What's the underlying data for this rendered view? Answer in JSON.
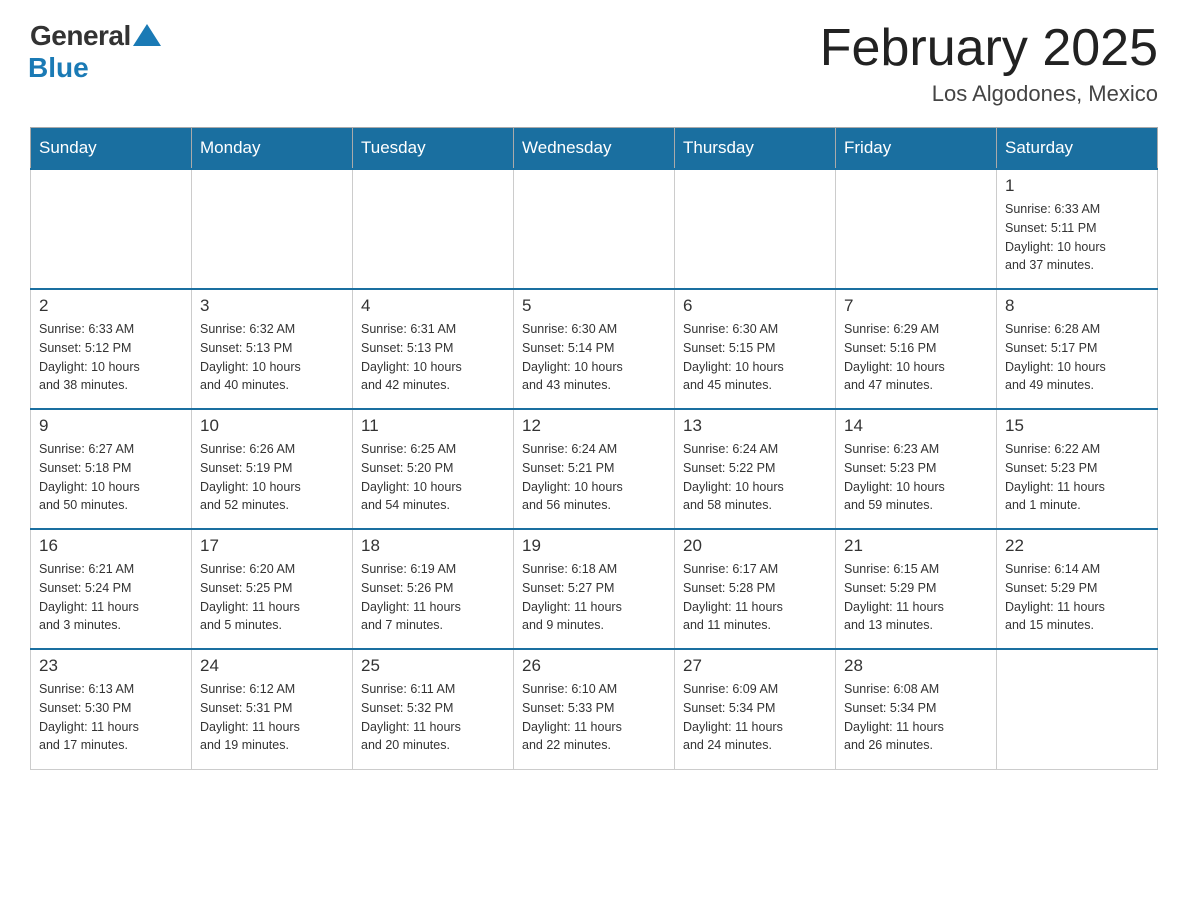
{
  "header": {
    "logo_general": "General",
    "logo_blue": "Blue",
    "month_title": "February 2025",
    "location": "Los Algodones, Mexico"
  },
  "weekdays": [
    "Sunday",
    "Monday",
    "Tuesday",
    "Wednesday",
    "Thursday",
    "Friday",
    "Saturday"
  ],
  "weeks": [
    [
      {
        "day": "",
        "info": ""
      },
      {
        "day": "",
        "info": ""
      },
      {
        "day": "",
        "info": ""
      },
      {
        "day": "",
        "info": ""
      },
      {
        "day": "",
        "info": ""
      },
      {
        "day": "",
        "info": ""
      },
      {
        "day": "1",
        "info": "Sunrise: 6:33 AM\nSunset: 5:11 PM\nDaylight: 10 hours\nand 37 minutes."
      }
    ],
    [
      {
        "day": "2",
        "info": "Sunrise: 6:33 AM\nSunset: 5:12 PM\nDaylight: 10 hours\nand 38 minutes."
      },
      {
        "day": "3",
        "info": "Sunrise: 6:32 AM\nSunset: 5:13 PM\nDaylight: 10 hours\nand 40 minutes."
      },
      {
        "day": "4",
        "info": "Sunrise: 6:31 AM\nSunset: 5:13 PM\nDaylight: 10 hours\nand 42 minutes."
      },
      {
        "day": "5",
        "info": "Sunrise: 6:30 AM\nSunset: 5:14 PM\nDaylight: 10 hours\nand 43 minutes."
      },
      {
        "day": "6",
        "info": "Sunrise: 6:30 AM\nSunset: 5:15 PM\nDaylight: 10 hours\nand 45 minutes."
      },
      {
        "day": "7",
        "info": "Sunrise: 6:29 AM\nSunset: 5:16 PM\nDaylight: 10 hours\nand 47 minutes."
      },
      {
        "day": "8",
        "info": "Sunrise: 6:28 AM\nSunset: 5:17 PM\nDaylight: 10 hours\nand 49 minutes."
      }
    ],
    [
      {
        "day": "9",
        "info": "Sunrise: 6:27 AM\nSunset: 5:18 PM\nDaylight: 10 hours\nand 50 minutes."
      },
      {
        "day": "10",
        "info": "Sunrise: 6:26 AM\nSunset: 5:19 PM\nDaylight: 10 hours\nand 52 minutes."
      },
      {
        "day": "11",
        "info": "Sunrise: 6:25 AM\nSunset: 5:20 PM\nDaylight: 10 hours\nand 54 minutes."
      },
      {
        "day": "12",
        "info": "Sunrise: 6:24 AM\nSunset: 5:21 PM\nDaylight: 10 hours\nand 56 minutes."
      },
      {
        "day": "13",
        "info": "Sunrise: 6:24 AM\nSunset: 5:22 PM\nDaylight: 10 hours\nand 58 minutes."
      },
      {
        "day": "14",
        "info": "Sunrise: 6:23 AM\nSunset: 5:23 PM\nDaylight: 10 hours\nand 59 minutes."
      },
      {
        "day": "15",
        "info": "Sunrise: 6:22 AM\nSunset: 5:23 PM\nDaylight: 11 hours\nand 1 minute."
      }
    ],
    [
      {
        "day": "16",
        "info": "Sunrise: 6:21 AM\nSunset: 5:24 PM\nDaylight: 11 hours\nand 3 minutes."
      },
      {
        "day": "17",
        "info": "Sunrise: 6:20 AM\nSunset: 5:25 PM\nDaylight: 11 hours\nand 5 minutes."
      },
      {
        "day": "18",
        "info": "Sunrise: 6:19 AM\nSunset: 5:26 PM\nDaylight: 11 hours\nand 7 minutes."
      },
      {
        "day": "19",
        "info": "Sunrise: 6:18 AM\nSunset: 5:27 PM\nDaylight: 11 hours\nand 9 minutes."
      },
      {
        "day": "20",
        "info": "Sunrise: 6:17 AM\nSunset: 5:28 PM\nDaylight: 11 hours\nand 11 minutes."
      },
      {
        "day": "21",
        "info": "Sunrise: 6:15 AM\nSunset: 5:29 PM\nDaylight: 11 hours\nand 13 minutes."
      },
      {
        "day": "22",
        "info": "Sunrise: 6:14 AM\nSunset: 5:29 PM\nDaylight: 11 hours\nand 15 minutes."
      }
    ],
    [
      {
        "day": "23",
        "info": "Sunrise: 6:13 AM\nSunset: 5:30 PM\nDaylight: 11 hours\nand 17 minutes."
      },
      {
        "day": "24",
        "info": "Sunrise: 6:12 AM\nSunset: 5:31 PM\nDaylight: 11 hours\nand 19 minutes."
      },
      {
        "day": "25",
        "info": "Sunrise: 6:11 AM\nSunset: 5:32 PM\nDaylight: 11 hours\nand 20 minutes."
      },
      {
        "day": "26",
        "info": "Sunrise: 6:10 AM\nSunset: 5:33 PM\nDaylight: 11 hours\nand 22 minutes."
      },
      {
        "day": "27",
        "info": "Sunrise: 6:09 AM\nSunset: 5:34 PM\nDaylight: 11 hours\nand 24 minutes."
      },
      {
        "day": "28",
        "info": "Sunrise: 6:08 AM\nSunset: 5:34 PM\nDaylight: 11 hours\nand 26 minutes."
      },
      {
        "day": "",
        "info": ""
      }
    ]
  ]
}
